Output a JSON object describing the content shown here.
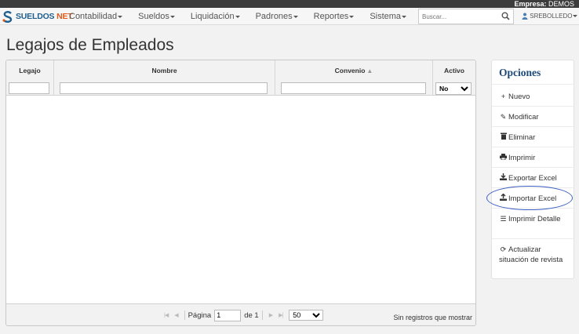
{
  "header": {
    "empresa_label": "Empresa:",
    "empresa_value": "DEMOS",
    "brand_main": "SUELDOS",
    "brand_suffix": "NET",
    "search_placeholder": "Buscar...",
    "user": "SREBOLLEDO",
    "menu": [
      {
        "label": "Contabilidad"
      },
      {
        "label": "Sueldos"
      },
      {
        "label": "Liquidación"
      },
      {
        "label": "Padrones"
      },
      {
        "label": "Reportes"
      },
      {
        "label": "Sistema"
      }
    ]
  },
  "page": {
    "title": "Legajos de Empleados"
  },
  "grid": {
    "columns": [
      {
        "label": "Legajo"
      },
      {
        "label": "Nombre"
      },
      {
        "label": "Convenio",
        "sort_icon": "sort-asc-icon"
      },
      {
        "label": "Activo"
      }
    ],
    "activo_filter": {
      "selected": "No"
    },
    "pager": {
      "page_label": "Página",
      "page_value": "1",
      "of_label": "de 1",
      "rows_per_page": "50"
    },
    "no_records": "Sin registros que mostrar"
  },
  "options": {
    "title": "Opciones",
    "items": [
      {
        "label": "Nuevo",
        "icon": "plus-icon"
      },
      {
        "label": "Modificar",
        "icon": "pencil-icon"
      },
      {
        "label": "Eliminar",
        "icon": "trash-icon"
      },
      {
        "label": "Imprimir",
        "icon": "print-icon"
      },
      {
        "label": "Exportar Excel",
        "icon": "download-icon"
      },
      {
        "label": "Importar Excel",
        "icon": "upload-icon"
      },
      {
        "label": "Imprimir Detalle",
        "icon": "list-icon"
      },
      {
        "label": "Actualizar situación de revista",
        "icon": "refresh-icon"
      }
    ]
  },
  "colors": {
    "accent": "#1e4a7a",
    "brand_blue": "#1e5f8f",
    "brand_orange": "#e05a1c",
    "annotation": "#3b5fc0",
    "topbar": "#3c3c3c"
  }
}
